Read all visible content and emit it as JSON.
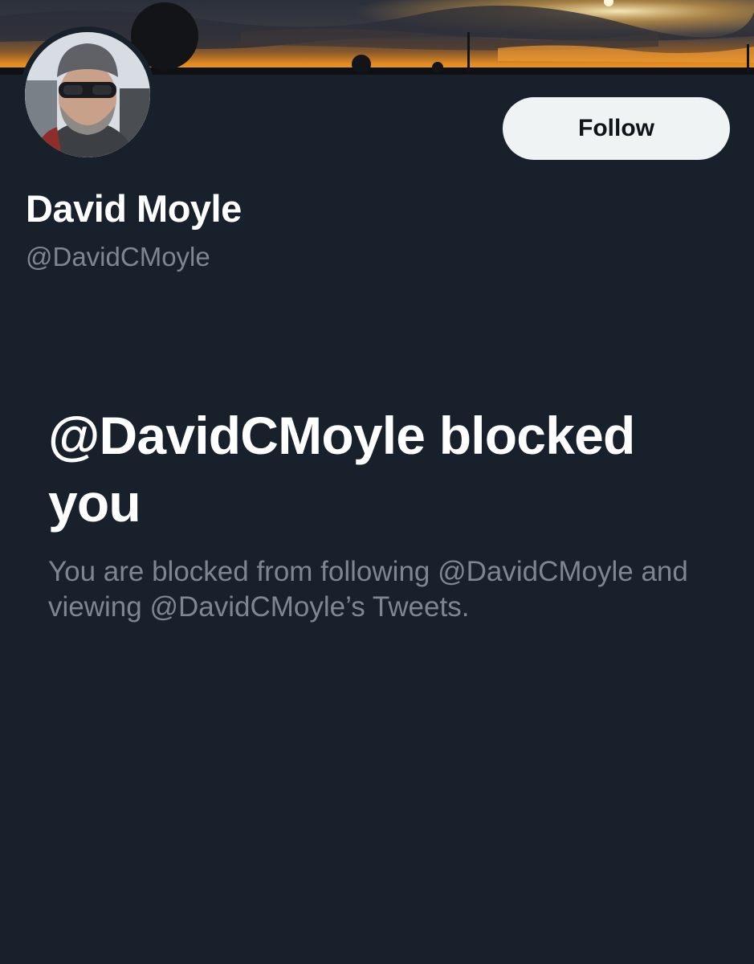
{
  "profile": {
    "display_name": "David Moyle",
    "handle": "@DavidCMoyle",
    "banner_image": "sunset-sky-banner",
    "avatar_image": "profile-photo"
  },
  "actions": {
    "follow_label": "Follow"
  },
  "blocked_notice": {
    "title": "@DavidCMoyle blocked you",
    "description": "You are blocked from following @DavidCMoyle and viewing @DavidCMoyle’s Tweets."
  },
  "colors": {
    "background": "#18202b",
    "primary_text": "#ffffff",
    "secondary_text": "#7d8791",
    "follow_button_bg": "#eff3f4",
    "follow_button_text": "#0f1419"
  }
}
